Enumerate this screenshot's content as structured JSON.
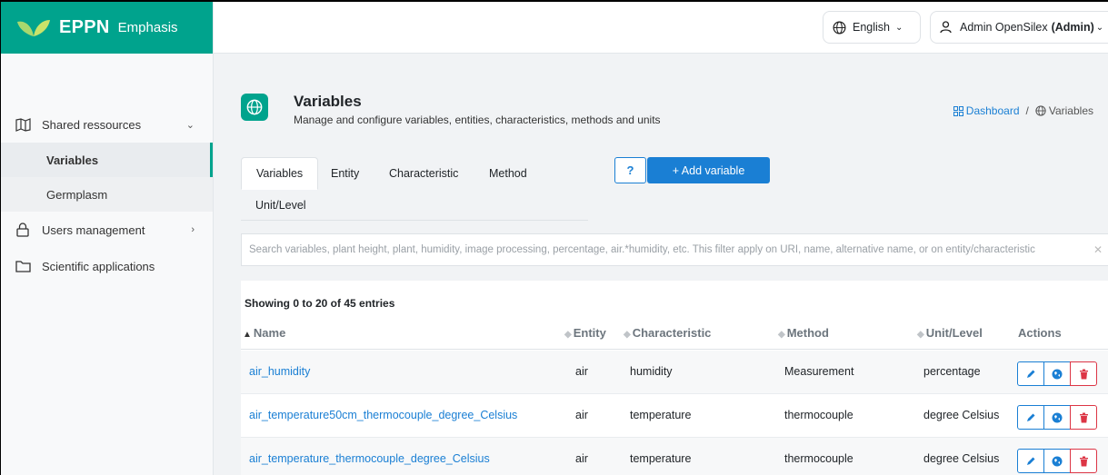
{
  "brand": {
    "title": "EPPN",
    "subtitle": "Emphasis"
  },
  "sidebar": {
    "items": [
      {
        "label": "Shared ressources",
        "icon": "map-icon",
        "chevron": "⌄"
      },
      {
        "label": "Variables"
      },
      {
        "label": "Germplasm"
      },
      {
        "label": "Users management",
        "icon": "lock-icon",
        "chevron": "›"
      },
      {
        "label": "Scientific applications",
        "icon": "folder-icon"
      }
    ]
  },
  "header": {
    "language": "English",
    "user_name": "Admin OpenSilex",
    "user_role": "(Admin)"
  },
  "page": {
    "title": "Variables",
    "description": "Manage and configure variables, entities, characteristics, methods and units",
    "breadcrumb": {
      "dashboard": "Dashboard",
      "separator": "/",
      "current": "Variables"
    }
  },
  "tabs": [
    "Variables",
    "Entity",
    "Characteristic",
    "Method",
    "Unit/Level"
  ],
  "buttons": {
    "help": "?",
    "add_variable": "+   Add variable"
  },
  "search": {
    "placeholder": "Search variables, plant height, plant, humidity, image processing, percentage, air.*humidity, etc. This filter apply on URI, name, alternative name, or on entity/characteristic",
    "clear": "✕"
  },
  "table": {
    "showing": "Showing 0 to 20 of 45 entries",
    "columns": [
      "Name",
      "Entity",
      "Characteristic",
      "Method",
      "Unit/Level",
      "Actions"
    ],
    "rows": [
      {
        "name": "air_humidity",
        "entity": "air",
        "characteristic": "humidity",
        "method": "Measurement",
        "unit": "percentage"
      },
      {
        "name": "air_temperature50cm_thermocouple_degree_Celsius",
        "entity": "air",
        "characteristic": "temperature",
        "method": "thermocouple",
        "unit": "degree Celsius"
      },
      {
        "name": "air_temperature_thermocouple_degree_Celsius",
        "entity": "air",
        "characteristic": "temperature",
        "method": "thermocouple",
        "unit": "degree Celsius"
      }
    ]
  },
  "colors": {
    "brand": "#00a38d",
    "primary": "#1a7fd4",
    "danger": "#dc3545"
  }
}
